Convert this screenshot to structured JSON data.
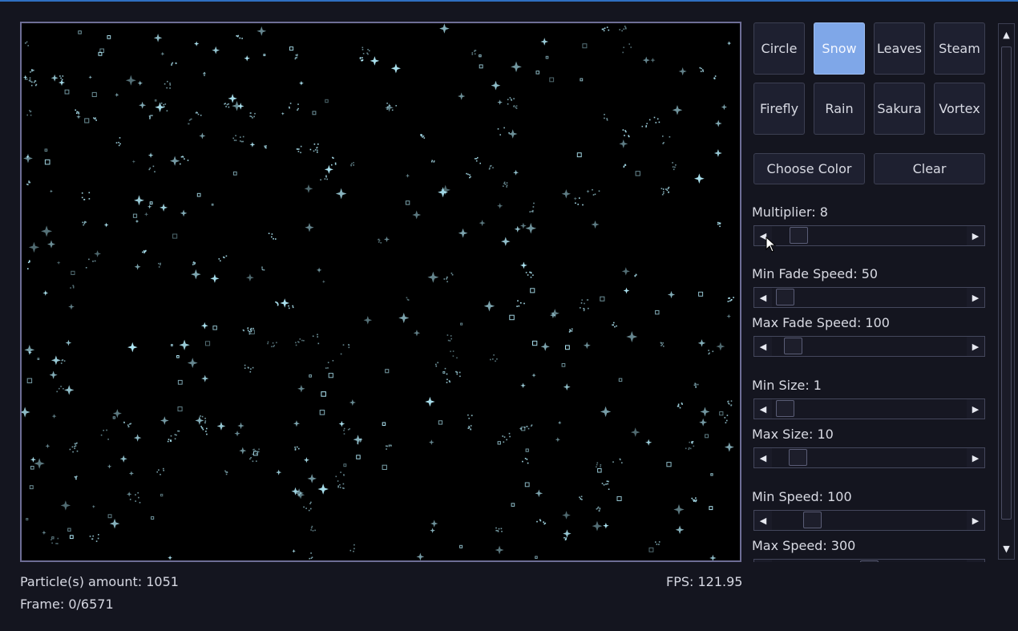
{
  "canvas": {
    "particle_color": "#aee6f4",
    "background": "#000000"
  },
  "status": {
    "amount": "Particle(s) amount: 1051",
    "frame": "Frame: 0/6571",
    "fps": "FPS: 121.95"
  },
  "presets": {
    "row1": [
      "Circle",
      "Snow",
      "Leaves",
      "Steam"
    ],
    "row2": [
      "Firefly",
      "Rain",
      "Sakura",
      "Vortex"
    ],
    "active": "Snow"
  },
  "actions": {
    "choose_color": "Choose Color",
    "clear": "Clear"
  },
  "sliders": [
    {
      "label": "Multiplier: 8"
    },
    {
      "label": "Min Fade Speed: 50"
    },
    {
      "label": "Max Fade Speed: 100"
    },
    {
      "label": "Min Size: 1"
    },
    {
      "label": "Max Size: 10"
    },
    {
      "label": "Min Speed: 100"
    },
    {
      "label": "Max Speed: 300"
    }
  ],
  "icons": {
    "left_arrow": "◀",
    "right_arrow": "▶",
    "up_arrow": "▲",
    "down_arrow": "▼"
  },
  "colors": {
    "accent": "#7fa7e8",
    "window_border": "#2f6fc2"
  }
}
